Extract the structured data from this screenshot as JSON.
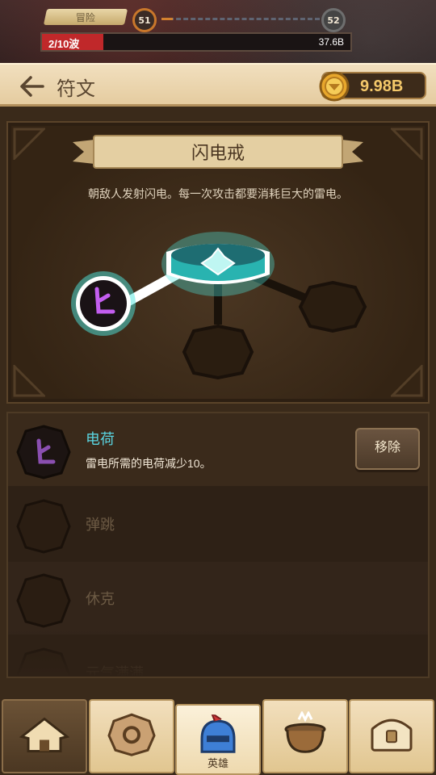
{
  "game": {
    "stage_tag": "冒险",
    "level_current": "51",
    "level_next": "52",
    "wave_text": "2/10波",
    "wave_progress": 0.2,
    "boss_hp": "37.6B"
  },
  "header": {
    "title": "符文",
    "gold": "9.98B"
  },
  "rune": {
    "name": "闪电戒",
    "description": "朝敌人发射闪电。每一次攻击都要消耗巨大的雷电。"
  },
  "list": {
    "items": [
      {
        "name": "电荷",
        "detail": "雷电所需的电荷减少10。",
        "button": "移除"
      },
      {
        "name": "弹跳"
      },
      {
        "name": "休克"
      },
      {
        "name": "元气满满"
      }
    ]
  },
  "nav": {
    "hero_label": "英雄"
  },
  "colors": {
    "cyan_glow": "#4de8e0",
    "purple_rune": "#b04adf",
    "gold": "#f4c86a",
    "active_name": "#5ad4e0"
  }
}
